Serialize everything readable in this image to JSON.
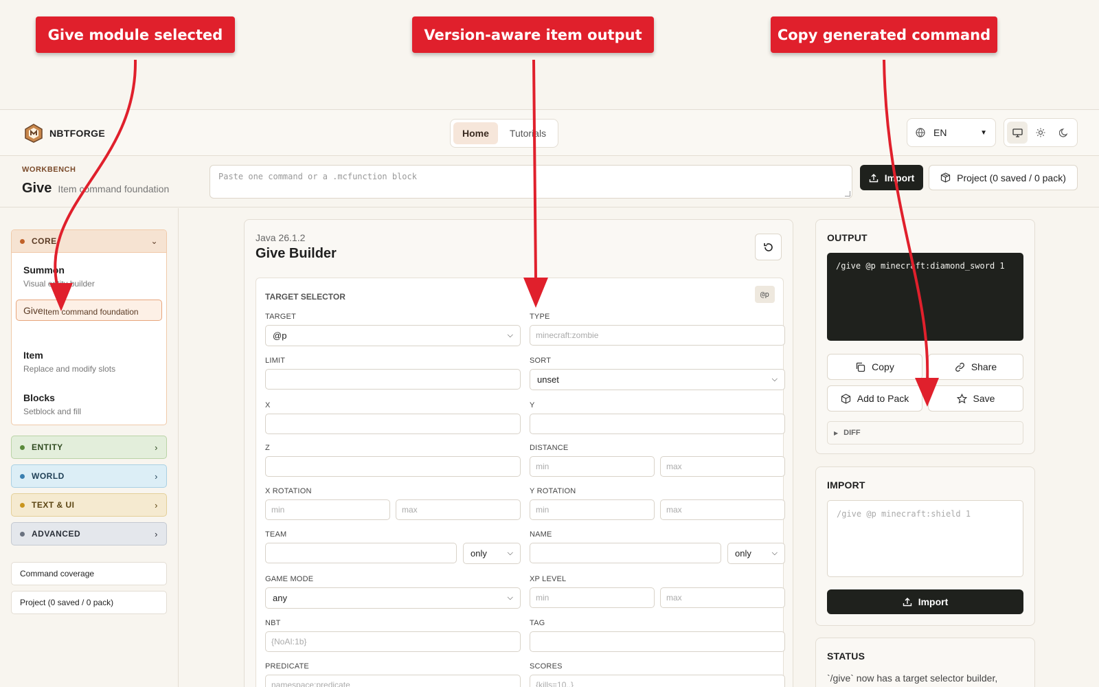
{
  "annotations": [
    {
      "text": "Give module selected"
    },
    {
      "text": "Version-aware item output"
    },
    {
      "text": "Copy generated command"
    }
  ],
  "header": {
    "brand": "NBTFORGE",
    "tabs": [
      "Home",
      "Tutorials"
    ],
    "active_tab": "Home",
    "language": "EN",
    "theme_modes": [
      "desktop-icon",
      "sun-icon",
      "moon-icon"
    ]
  },
  "workbench": {
    "label": "WORKBENCH",
    "title": "Give",
    "subtitle": "Item command foundation",
    "paste_placeholder": "Paste one command or a .mcfunction block",
    "import_label": "Import",
    "project_label": "Project (0 saved / 0 pack)"
  },
  "sidebar": {
    "core": {
      "label": "CORE",
      "modules": [
        {
          "name": "Summon",
          "desc": "Visual entity builder"
        },
        {
          "name": "Give",
          "desc": "Item command foundation"
        },
        {
          "name": "Item",
          "desc": "Replace and modify slots"
        },
        {
          "name": "Blocks",
          "desc": "Setblock and fill"
        }
      ],
      "selected": "Give"
    },
    "categories": [
      {
        "label": "ENTITY",
        "color": "#5a8a3a"
      },
      {
        "label": "WORLD",
        "color": "#3a7fb0"
      },
      {
        "label": "TEXT & UI",
        "color": "#c9951e"
      },
      {
        "label": "ADVANCED",
        "color": "#6a7280"
      }
    ],
    "buttons": [
      "Command coverage",
      "Project (0 saved / 0 pack)"
    ]
  },
  "builder": {
    "version": "Java 26.1.2",
    "title": "Give Builder",
    "section": "TARGET SELECTOR",
    "badge": "@p",
    "fields": {
      "target_label": "TARGET",
      "target_value": "@p",
      "type_label": "TYPE",
      "type_placeholder": "minecraft:zombie",
      "limit_label": "LIMIT",
      "sort_label": "SORT",
      "sort_value": "unset",
      "x_label": "X",
      "y_label": "Y",
      "z_label": "Z",
      "distance_label": "DISTANCE",
      "xrot_label": "X ROTATION",
      "yrot_label": "Y ROTATION",
      "min": "min",
      "max": "max",
      "team_label": "TEAM",
      "name_label": "NAME",
      "only": "only",
      "gamemode_label": "GAME MODE",
      "gamemode_value": "any",
      "xp_label": "XP LEVEL",
      "nbt_label": "NBT",
      "nbt_placeholder": "{NoAI:1b}",
      "tag_label": "TAG",
      "predicate_label": "PREDICATE",
      "predicate_placeholder": "namespace:predicate",
      "scores_label": "SCORES",
      "scores_placeholder": "{kills=10..}"
    }
  },
  "output": {
    "title": "OUTPUT",
    "command": "/give @p minecraft:diamond_sword 1",
    "copy": "Copy",
    "share": "Share",
    "add_to_pack": "Add to Pack",
    "save": "Save",
    "diff": "DIFF"
  },
  "import_panel": {
    "title": "IMPORT",
    "placeholder": "/give @p minecraft:shield 1",
    "button": "Import"
  },
  "status": {
    "title": "STATUS",
    "text": "`/give` now has a target selector builder,"
  },
  "colors": {
    "accent": "#e0202c",
    "dark": "#1f211d",
    "selected_bg": "#fdf0e6"
  }
}
